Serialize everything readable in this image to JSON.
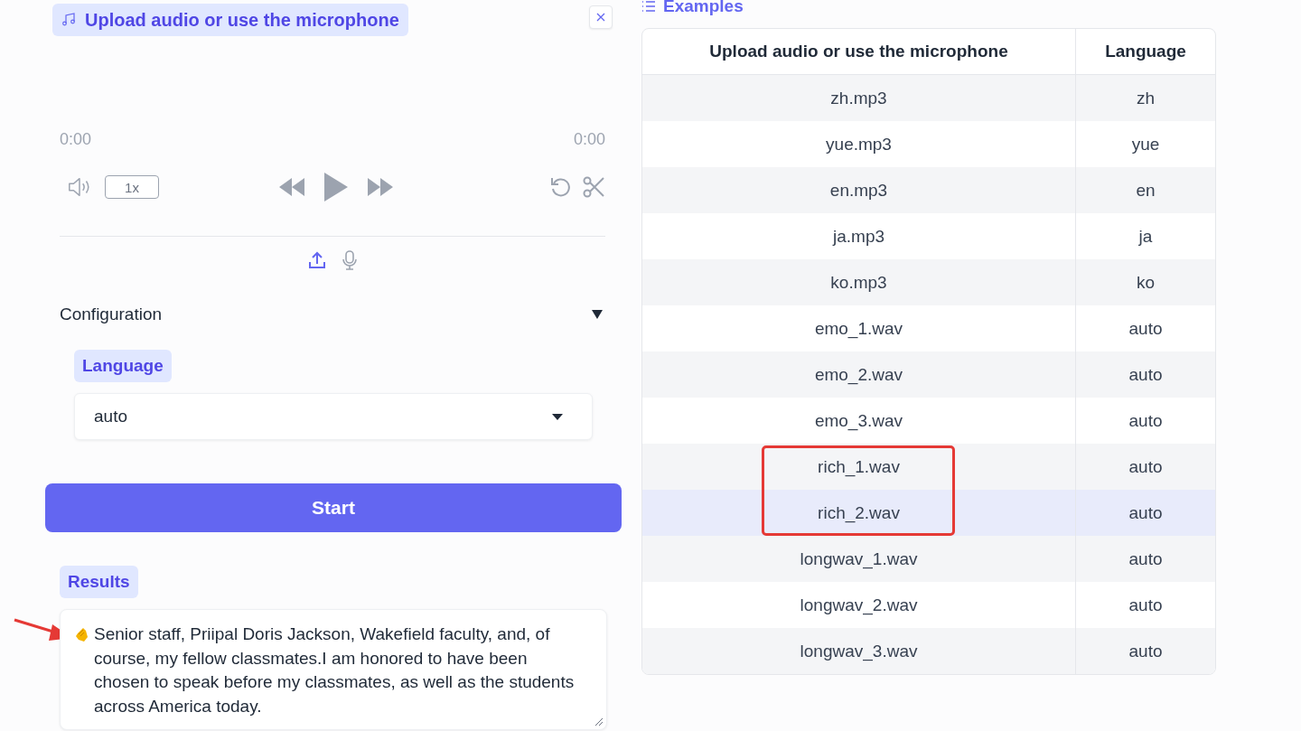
{
  "audio": {
    "label": "Upload audio or use the microphone",
    "time_current": "0:00",
    "time_total": "0:00",
    "speed": "1x"
  },
  "configuration": {
    "title": "Configuration",
    "expanded": true,
    "language_label": "Language",
    "language_value": "auto"
  },
  "start_button": "Start",
  "results": {
    "label": "Results",
    "text": "Senior staff, Priipal Doris Jackson, Wakefield faculty, and, of course, my fellow classmates.I am honored to have been chosen to speak before my classmates, as well as the students across America today.",
    "arrow": true
  },
  "examples": {
    "title": "Examples",
    "columns": [
      "Upload audio or use the microphone",
      "Language"
    ],
    "rows": [
      {
        "file": "zh.mp3",
        "language": "zh",
        "selected": false,
        "boxed": false
      },
      {
        "file": "yue.mp3",
        "language": "yue",
        "selected": false,
        "boxed": false
      },
      {
        "file": "en.mp3",
        "language": "en",
        "selected": false,
        "boxed": false
      },
      {
        "file": "ja.mp3",
        "language": "ja",
        "selected": false,
        "boxed": false
      },
      {
        "file": "ko.mp3",
        "language": "ko",
        "selected": false,
        "boxed": false
      },
      {
        "file": "emo_1.wav",
        "language": "auto",
        "selected": false,
        "boxed": false
      },
      {
        "file": "emo_2.wav",
        "language": "auto",
        "selected": false,
        "boxed": false
      },
      {
        "file": "emo_3.wav",
        "language": "auto",
        "selected": false,
        "boxed": false
      },
      {
        "file": "rich_1.wav",
        "language": "auto",
        "selected": false,
        "boxed": true
      },
      {
        "file": "rich_2.wav",
        "language": "auto",
        "selected": true,
        "boxed": true
      },
      {
        "file": "longwav_1.wav",
        "language": "auto",
        "selected": false,
        "boxed": false
      },
      {
        "file": "longwav_2.wav",
        "language": "auto",
        "selected": false,
        "boxed": false
      },
      {
        "file": "longwav_3.wav",
        "language": "auto",
        "selected": false,
        "boxed": false
      }
    ]
  }
}
